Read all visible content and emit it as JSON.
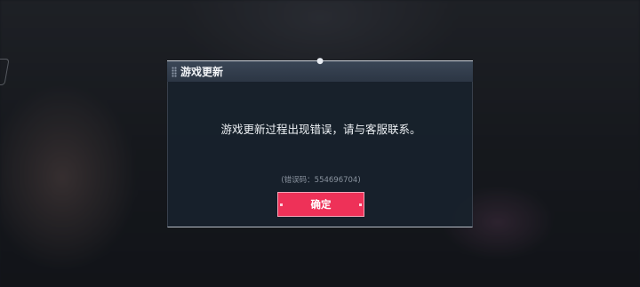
{
  "dialog": {
    "title": "游戏更新",
    "message": "游戏更新过程出现错误，请与客服联系。",
    "error_code": "(错误码：554696704)",
    "confirm_label": "确定"
  },
  "colors": {
    "button": "#ee3158",
    "header": "#323d4b",
    "body": "#18222c"
  },
  "icons": [
    "grip-icon",
    "anchor-dot-icon"
  ]
}
